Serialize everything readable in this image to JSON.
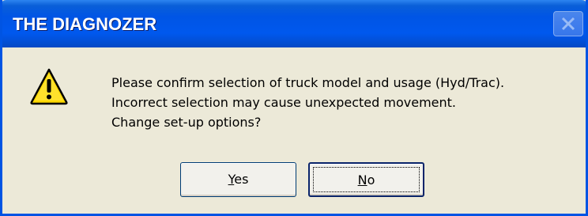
{
  "window": {
    "title": "THE DIAGNOZER",
    "close_icon": "close-icon"
  },
  "message": {
    "icon": "warning-icon",
    "lines": [
      "Please confirm selection of truck model and usage (Hyd/Trac).",
      "Incorrect selection may cause unexpected movement.",
      "Change set-up options?"
    ]
  },
  "buttons": {
    "yes": {
      "mnemonic": "Y",
      "rest": "es"
    },
    "no": {
      "mnemonic": "N",
      "rest": "o"
    }
  },
  "colors": {
    "titlebar": "#0055e5",
    "dialog_bg": "#ece9d8",
    "warning_yellow": "#ffd800"
  }
}
